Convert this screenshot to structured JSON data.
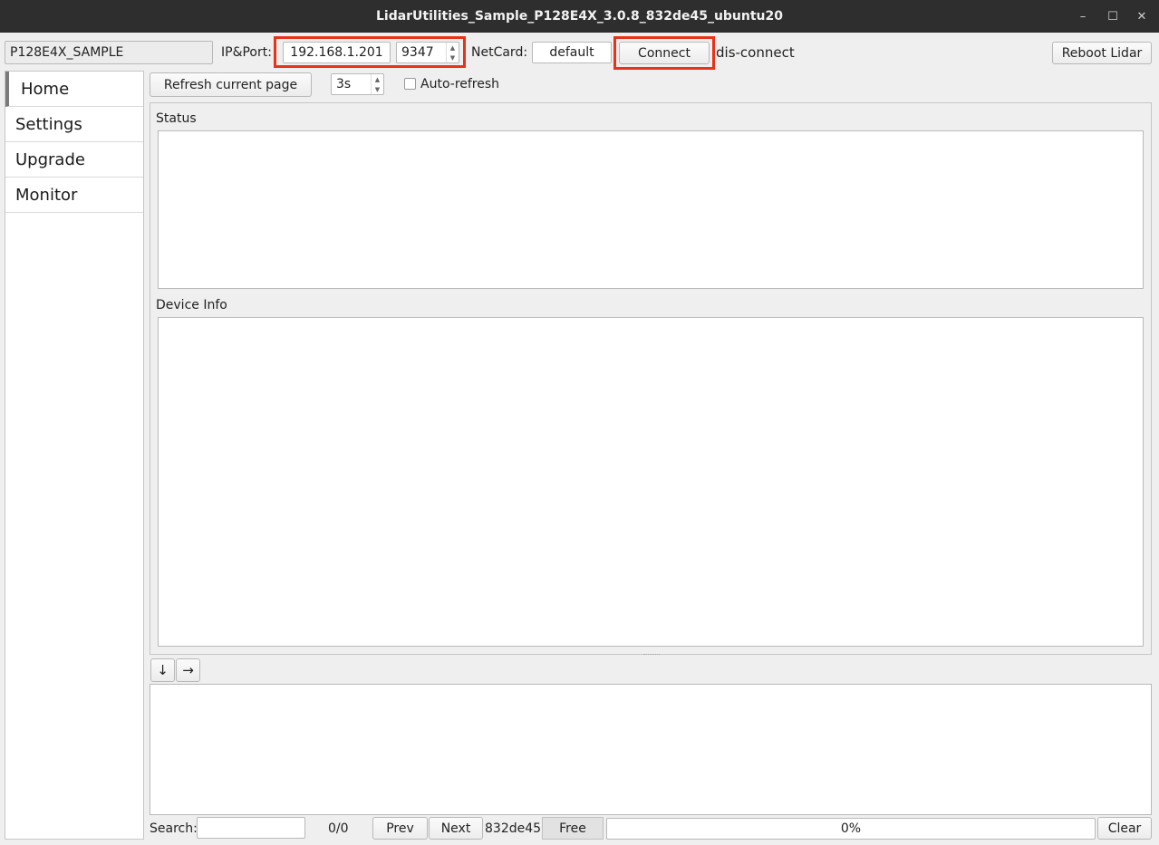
{
  "window": {
    "title": "LidarUtilities_Sample_P128E4X_3.0.8_832de45_ubuntu20",
    "minimize": "–",
    "maximize": "☐",
    "close": "✕"
  },
  "toolbar": {
    "device_name": "P128E4X_SAMPLE",
    "ip_port_label": "IP&Port:",
    "ip_value": "192.168.1.201",
    "port_value": "9347",
    "netcard_label": "NetCard:",
    "netcard_value": "default",
    "connect_label": "Connect",
    "connection_status": "dis-connect",
    "reboot_label": "Reboot Lidar"
  },
  "sidebar": {
    "items": [
      {
        "label": "Home"
      },
      {
        "label": "Settings"
      },
      {
        "label": "Upgrade"
      },
      {
        "label": "Monitor"
      }
    ]
  },
  "home": {
    "refresh_label": "Refresh current page",
    "interval_value": "3s",
    "auto_refresh_label": "Auto-refresh",
    "status_title": "Status",
    "device_info_title": "Device Info"
  },
  "log": {
    "down_arrow": "↓",
    "right_arrow": "→"
  },
  "footer": {
    "search_label": "Search:",
    "search_value": "",
    "match_count": "0/0",
    "prev_label": "Prev",
    "next_label": "Next",
    "version": "832de45",
    "free_label": "Free",
    "progress_text": "0%",
    "progress_percent": 0,
    "clear_label": "Clear"
  },
  "colors": {
    "highlight": "#e8321a",
    "titlebar": "#2e2e2e"
  }
}
